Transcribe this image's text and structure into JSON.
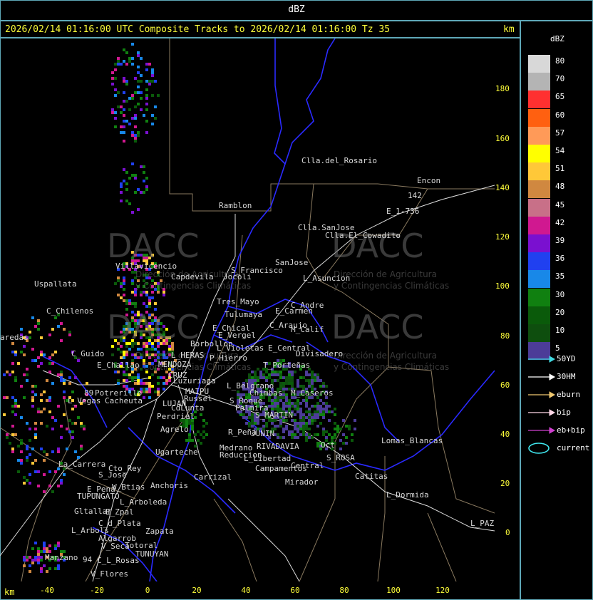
{
  "top_title": "dBZ",
  "header": {
    "text": "2026/02/14 01:16:00 UTC Composite Tracks to 2026/02/14 01:16:00 Tz 35",
    "km": "km"
  },
  "axes": {
    "x_ticks": [
      "-40",
      "-20",
      "0",
      "20",
      "40",
      "60",
      "80",
      "100",
      "120"
    ],
    "y_ticks": [
      "180",
      "160",
      "140",
      "120",
      "100",
      "80",
      "60",
      "40",
      "20",
      "0"
    ],
    "bottom_km": "km"
  },
  "legend": {
    "title": "dBZ",
    "scale": [
      {
        "label": "80",
        "color": "#d8d8d8"
      },
      {
        "label": "70",
        "color": "#b4b4b4"
      },
      {
        "label": "65",
        "color": "#ff3030"
      },
      {
        "label": "60",
        "color": "#ff6010"
      },
      {
        "label": "57",
        "color": "#ff9a58"
      },
      {
        "label": "54",
        "color": "#ffff00"
      },
      {
        "label": "51",
        "color": "#ffc838"
      },
      {
        "label": "48",
        "color": "#d08840"
      },
      {
        "label": "45",
        "color": "#c87088"
      },
      {
        "label": "42",
        "color": "#d01890"
      },
      {
        "label": "39",
        "color": "#7a10d0"
      },
      {
        "label": "36",
        "color": "#2040f0"
      },
      {
        "label": "35",
        "color": "#1888e8"
      },
      {
        "label": "30",
        "color": "#108010"
      },
      {
        "label": "20",
        "color": "#0a5a0a"
      },
      {
        "label": "10",
        "color": "#0e4e0e"
      },
      {
        "label": "5",
        "color": "#4c3c98"
      }
    ],
    "tracks": [
      {
        "label": "50YD",
        "color": "#40d8e0"
      },
      {
        "label": "30HM",
        "color": "#ffffff"
      },
      {
        "label": "eburn",
        "color": "#f0c870"
      },
      {
        "label": "bip",
        "color": "#ffd8e8"
      },
      {
        "label": "eb+bip",
        "color": "#d040d0"
      },
      {
        "label": "current",
        "color": "#40e8f0"
      }
    ]
  },
  "watermark": {
    "brand": "DACC",
    "line1": "Dirección de Agricultura",
    "line2": "y Contingencias Climáticas"
  },
  "places": {
    "clla_del_rosario": "Clla.del_Rosario",
    "encon": "Encon",
    "e_1_736": "E_1-736",
    "rn142": "142",
    "ramblon": "Ramblon",
    "clla_sanjose": "Clla.SanJose",
    "clla_el_cowadito": "Clla.El_Cowadito",
    "villavicencio": "Villavicencio",
    "capdevila": "Capdevila",
    "s_francisco": "S_Francisco",
    "sanjose": "SanJose",
    "l_asuncion": "L_Asuncion",
    "uspallata": "Uspallata",
    "jocoli": "Jocoli",
    "tres_mayo": "Tres_Mayo",
    "tulumaya": "Tulumaya",
    "c_andre": "C_Andre",
    "e_carmen": "E_Carmen",
    "c_chilenos": "C_Chilenos",
    "e_chical": "E_Chical",
    "e_vergel": "E_Vergel",
    "c_araujo": "C_Araujo",
    "m_calif": "M_Calif",
    "paredas": "aredas",
    "borbollon": "Borbollon",
    "l_violetas": "L_Violetas",
    "e_central": "E_Central",
    "divisadero": "Divisadero",
    "p_hierro": "P_Hierro",
    "c_guido": "C_Guido",
    "e_challao": "E_Challao",
    "l_heras": "L_HERAS",
    "mendoza": "MENDOZA",
    "t_portenas": "T_Porteñas",
    "cruz": "CRUZ",
    "luzuriaga": "Luzuriaga",
    "l_belgrano": "L_Belgrano",
    "maipu": "MAIPU",
    "chimbas": "Chimbas",
    "m_caseros": "M_Caseros",
    "potrerillo": "Potrerillo",
    "rn89": "89",
    "russel": "Russel",
    "l_vegas": "L_Vegas",
    "cacheuta": "Cacheuta",
    "lujan": "LUJAN",
    "cdlunta": "CdLunta",
    "s_roque": "S_Roque",
    "palmira": "Palmira",
    "s_martin": "S_MARTIN",
    "perdriel": "Perdriel",
    "agrelo": "Agrelo",
    "r_pena": "R_Peña",
    "junin": "JUNIN",
    "rivadavia": "RIVADAVIA",
    "l_oct": "Oct",
    "ugarteche": "Ugarteche",
    "medrano": "Medrano",
    "reduccion": "Reduccion",
    "lomas_blancas": "Lomas_Blancas",
    "la_carrera": "La_Carrera",
    "cto_rey": "Cto_Rey",
    "s_jose": "S_Jose",
    "l_libertad": "L_Libertad",
    "campamentos": "Campamentos",
    "central": "Central",
    "s_rosa": "S_ROSA",
    "carrizal": "Carrizal",
    "catitas": "Catitas",
    "w_btias": "W_Btias",
    "anchoris": "Anchoris",
    "e_pena": "E_Pena",
    "tupungato": "TUPUNGATO",
    "mirador": "Mirador",
    "l_dormida": "L_Dormida",
    "l_arboleda": "L_Arboleda",
    "gltallar": "Gltallar",
    "e_zpal": "E_Zpal",
    "c_d_plata": "C_d_Plata",
    "l_paz": "L_PAZ",
    "l_arbols": "L_Arbols",
    "zapata": "Zapata",
    "algarrob": "Algarrob",
    "v_seca": "V_Seca",
    "totoral": "Totoral",
    "tunuyan": "TUNUYAN",
    "manzano": "Manzano",
    "rn94": "94",
    "c_l_rosas": "C_L_Rosas",
    "v_flores": "V_Flores"
  }
}
